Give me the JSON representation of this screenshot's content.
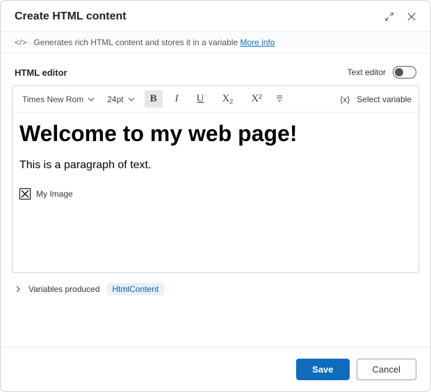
{
  "header": {
    "title": "Create HTML content"
  },
  "banner": {
    "icon": "</>",
    "text": "Generates rich HTML content and stores it in a variable",
    "link_text": "More info"
  },
  "editor": {
    "header_label": "HTML editor",
    "text_editor_label": "Text editor",
    "toolbar": {
      "font_family": "Times New Rom",
      "font_size": "24pt",
      "select_variable_label": "Select variable"
    },
    "content": {
      "heading": "Welcome to my web page!",
      "paragraph": "This is a paragraph of text.",
      "image_alt": "My Image"
    }
  },
  "variables": {
    "label": "Variables produced",
    "items": [
      "HtmlContent"
    ]
  },
  "footer": {
    "save": "Save",
    "cancel": "Cancel"
  }
}
